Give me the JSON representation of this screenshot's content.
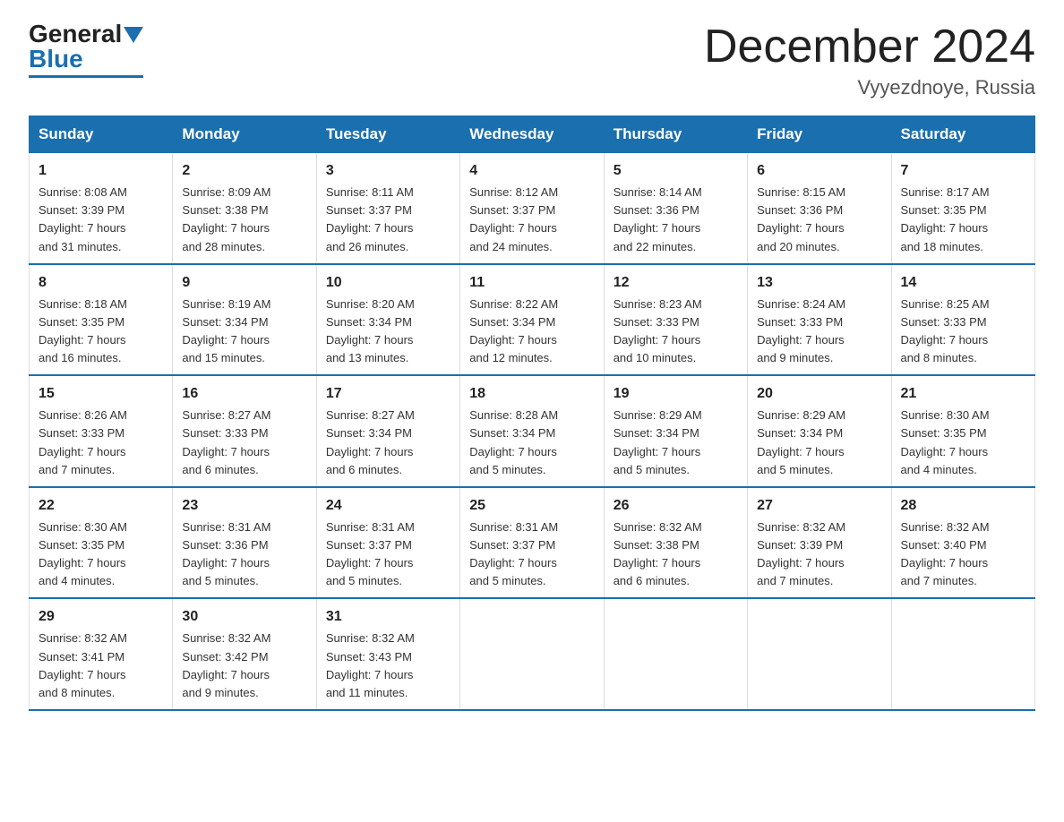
{
  "logo": {
    "general": "General",
    "blue": "Blue"
  },
  "title": "December 2024",
  "subtitle": "Vyyezdnoye, Russia",
  "days_of_week": [
    "Sunday",
    "Monday",
    "Tuesday",
    "Wednesday",
    "Thursday",
    "Friday",
    "Saturday"
  ],
  "weeks": [
    [
      {
        "num": "1",
        "info": "Sunrise: 8:08 AM\nSunset: 3:39 PM\nDaylight: 7 hours\nand 31 minutes."
      },
      {
        "num": "2",
        "info": "Sunrise: 8:09 AM\nSunset: 3:38 PM\nDaylight: 7 hours\nand 28 minutes."
      },
      {
        "num": "3",
        "info": "Sunrise: 8:11 AM\nSunset: 3:37 PM\nDaylight: 7 hours\nand 26 minutes."
      },
      {
        "num": "4",
        "info": "Sunrise: 8:12 AM\nSunset: 3:37 PM\nDaylight: 7 hours\nand 24 minutes."
      },
      {
        "num": "5",
        "info": "Sunrise: 8:14 AM\nSunset: 3:36 PM\nDaylight: 7 hours\nand 22 minutes."
      },
      {
        "num": "6",
        "info": "Sunrise: 8:15 AM\nSunset: 3:36 PM\nDaylight: 7 hours\nand 20 minutes."
      },
      {
        "num": "7",
        "info": "Sunrise: 8:17 AM\nSunset: 3:35 PM\nDaylight: 7 hours\nand 18 minutes."
      }
    ],
    [
      {
        "num": "8",
        "info": "Sunrise: 8:18 AM\nSunset: 3:35 PM\nDaylight: 7 hours\nand 16 minutes."
      },
      {
        "num": "9",
        "info": "Sunrise: 8:19 AM\nSunset: 3:34 PM\nDaylight: 7 hours\nand 15 minutes."
      },
      {
        "num": "10",
        "info": "Sunrise: 8:20 AM\nSunset: 3:34 PM\nDaylight: 7 hours\nand 13 minutes."
      },
      {
        "num": "11",
        "info": "Sunrise: 8:22 AM\nSunset: 3:34 PM\nDaylight: 7 hours\nand 12 minutes."
      },
      {
        "num": "12",
        "info": "Sunrise: 8:23 AM\nSunset: 3:33 PM\nDaylight: 7 hours\nand 10 minutes."
      },
      {
        "num": "13",
        "info": "Sunrise: 8:24 AM\nSunset: 3:33 PM\nDaylight: 7 hours\nand 9 minutes."
      },
      {
        "num": "14",
        "info": "Sunrise: 8:25 AM\nSunset: 3:33 PM\nDaylight: 7 hours\nand 8 minutes."
      }
    ],
    [
      {
        "num": "15",
        "info": "Sunrise: 8:26 AM\nSunset: 3:33 PM\nDaylight: 7 hours\nand 7 minutes."
      },
      {
        "num": "16",
        "info": "Sunrise: 8:27 AM\nSunset: 3:33 PM\nDaylight: 7 hours\nand 6 minutes."
      },
      {
        "num": "17",
        "info": "Sunrise: 8:27 AM\nSunset: 3:34 PM\nDaylight: 7 hours\nand 6 minutes."
      },
      {
        "num": "18",
        "info": "Sunrise: 8:28 AM\nSunset: 3:34 PM\nDaylight: 7 hours\nand 5 minutes."
      },
      {
        "num": "19",
        "info": "Sunrise: 8:29 AM\nSunset: 3:34 PM\nDaylight: 7 hours\nand 5 minutes."
      },
      {
        "num": "20",
        "info": "Sunrise: 8:29 AM\nSunset: 3:34 PM\nDaylight: 7 hours\nand 5 minutes."
      },
      {
        "num": "21",
        "info": "Sunrise: 8:30 AM\nSunset: 3:35 PM\nDaylight: 7 hours\nand 4 minutes."
      }
    ],
    [
      {
        "num": "22",
        "info": "Sunrise: 8:30 AM\nSunset: 3:35 PM\nDaylight: 7 hours\nand 4 minutes."
      },
      {
        "num": "23",
        "info": "Sunrise: 8:31 AM\nSunset: 3:36 PM\nDaylight: 7 hours\nand 5 minutes."
      },
      {
        "num": "24",
        "info": "Sunrise: 8:31 AM\nSunset: 3:37 PM\nDaylight: 7 hours\nand 5 minutes."
      },
      {
        "num": "25",
        "info": "Sunrise: 8:31 AM\nSunset: 3:37 PM\nDaylight: 7 hours\nand 5 minutes."
      },
      {
        "num": "26",
        "info": "Sunrise: 8:32 AM\nSunset: 3:38 PM\nDaylight: 7 hours\nand 6 minutes."
      },
      {
        "num": "27",
        "info": "Sunrise: 8:32 AM\nSunset: 3:39 PM\nDaylight: 7 hours\nand 7 minutes."
      },
      {
        "num": "28",
        "info": "Sunrise: 8:32 AM\nSunset: 3:40 PM\nDaylight: 7 hours\nand 7 minutes."
      }
    ],
    [
      {
        "num": "29",
        "info": "Sunrise: 8:32 AM\nSunset: 3:41 PM\nDaylight: 7 hours\nand 8 minutes."
      },
      {
        "num": "30",
        "info": "Sunrise: 8:32 AM\nSunset: 3:42 PM\nDaylight: 7 hours\nand 9 minutes."
      },
      {
        "num": "31",
        "info": "Sunrise: 8:32 AM\nSunset: 3:43 PM\nDaylight: 7 hours\nand 11 minutes."
      },
      null,
      null,
      null,
      null
    ]
  ]
}
